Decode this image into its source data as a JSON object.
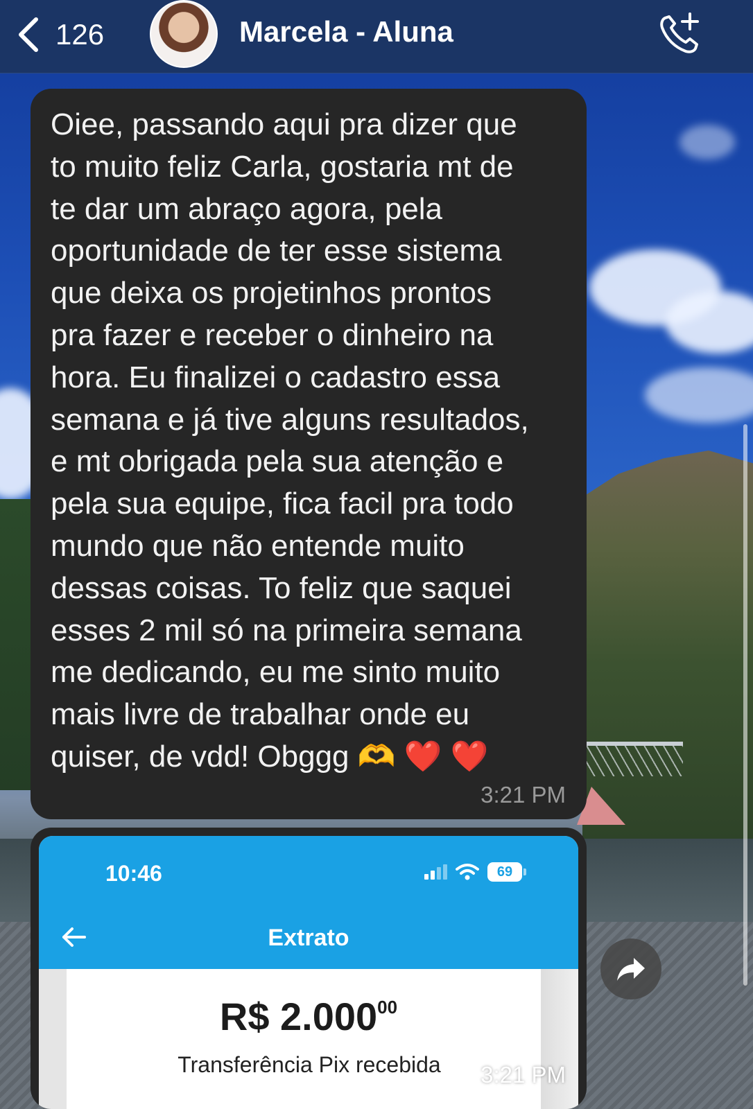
{
  "header": {
    "back_count": "126",
    "contact_name": "Marcela - Aluna",
    "back_icon": "chevron-left-icon",
    "call_icon": "phone-add-icon",
    "bar_color": "#1b3565"
  },
  "messages": [
    {
      "type": "text",
      "text": "Oiee, passando aqui pra dizer que\nto muito feliz Carla, gostaria mt de\nte dar um abraço agora, pela\noportunidade de ter esse sistema\nque deixa os projetinhos prontos\npra fazer e receber o dinheiro na\nhora. Eu finalizei o cadastro essa\nsemana e já tive alguns resultados,\ne mt obrigada pela sua atenção e\npela sua equipe, fica facil pra todo\nmundo que não entende muito\ndessas coisas. To feliz que saquei\nesses 2 mil só na primeira semana\nme dedicando, eu me sinto muito\nmais livre de trabalhar onde eu\nquiser, de vdd! Obggg 🫶 ❤️ ❤️",
      "time": "3:21 PM",
      "bubble_color": "#262626"
    },
    {
      "type": "image",
      "time": "3:21 PM",
      "screenshot": {
        "status_time": "10:46",
        "battery": "69",
        "title": "Extrato",
        "amount": "R$ 2.000",
        "cents": "00",
        "label": "Transferência Pix recebida",
        "accent": "#1aa1e4"
      }
    }
  ],
  "forward_icon": "forward-share-icon"
}
